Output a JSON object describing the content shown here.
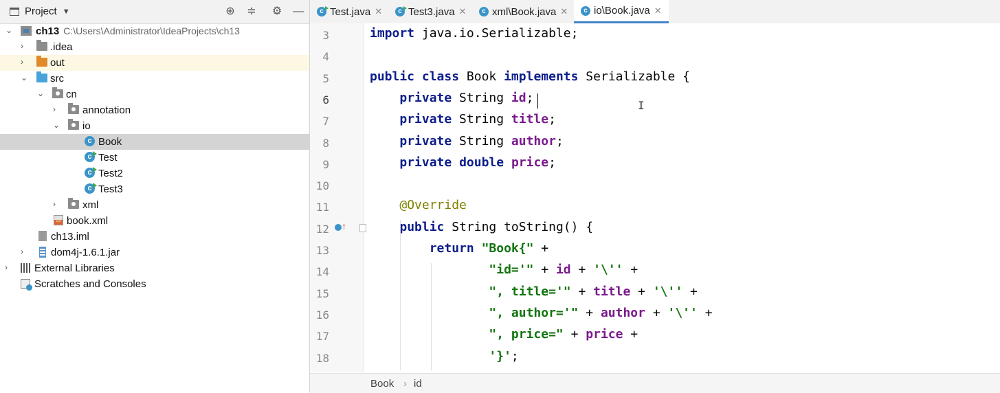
{
  "project_panel": {
    "title": "Project",
    "header_icons": [
      "globe-icon",
      "collapse-icon",
      "gear-icon",
      "minimize-icon"
    ],
    "tree": [
      {
        "name": "ch13",
        "path": "C:\\Users\\Administrator\\IdeaProjects\\ch13",
        "icon": "module-folder-icon",
        "expanded": true
      },
      {
        "name": ".idea",
        "icon": "folder-icon",
        "expanded": false
      },
      {
        "name": "out",
        "icon": "excluded-folder-icon",
        "expanded": false
      },
      {
        "name": "src",
        "icon": "source-folder-icon",
        "expanded": true
      },
      {
        "name": "cn",
        "icon": "package-icon",
        "expanded": true
      },
      {
        "name": "annotation",
        "icon": "package-icon",
        "expanded": false
      },
      {
        "name": "io",
        "icon": "package-icon",
        "expanded": true
      },
      {
        "name": "Book",
        "icon": "class-icon",
        "selected": true
      },
      {
        "name": "Test",
        "icon": "runnable-class-icon"
      },
      {
        "name": "Test2",
        "icon": "runnable-class-icon"
      },
      {
        "name": "Test3",
        "icon": "runnable-class-icon"
      },
      {
        "name": "xml",
        "icon": "package-icon",
        "expanded": false
      },
      {
        "name": "book.xml",
        "icon": "xml-file-icon"
      },
      {
        "name": "ch13.iml",
        "icon": "iml-file-icon"
      },
      {
        "name": "dom4j-1.6.1.jar",
        "icon": "jar-icon",
        "expanded": false
      },
      {
        "name": "External Libraries",
        "icon": "libraries-icon",
        "expanded": false
      },
      {
        "name": "Scratches and Consoles",
        "icon": "scratches-icon"
      }
    ]
  },
  "tabs": [
    {
      "label": "Test.java",
      "runnable": true,
      "active": false
    },
    {
      "label": "Test3.java",
      "runnable": true,
      "active": false
    },
    {
      "label": "xml\\Book.java",
      "runnable": false,
      "active": false
    },
    {
      "label": "io\\Book.java",
      "runnable": false,
      "active": true
    }
  ],
  "editor": {
    "current_line": 6,
    "line_numbers": [
      "3",
      "4",
      "5",
      "6",
      "7",
      "8",
      "9",
      "10",
      "11",
      "12",
      "13",
      "14",
      "15",
      "16",
      "17",
      "18"
    ],
    "lines": [
      "import java.io.Serializable;",
      "",
      "public class Book implements Serializable {",
      "    private String id;",
      "    private String title;",
      "    private String author;",
      "    private double price;",
      "",
      "    @Override",
      "    public String toString() {",
      "        return \"Book{\" +",
      "                \"id='\" + id + '\\'' +",
      "                \", title='\" + title + '\\'' +",
      "                \", author='\" + author + '\\'' +",
      "                \", price=\" + price +",
      "                '}';"
    ]
  },
  "breadcrumb": {
    "items": [
      "Book",
      "id"
    ],
    "separator": "›"
  },
  "colors": {
    "keyword": "#0d1e8c",
    "field": "#7a1a8c",
    "string": "#12740e",
    "annotation": "#808000",
    "current_line": "#fdf7e1",
    "selection": "#d4d4d4",
    "tab_underline": "#4083c9"
  }
}
